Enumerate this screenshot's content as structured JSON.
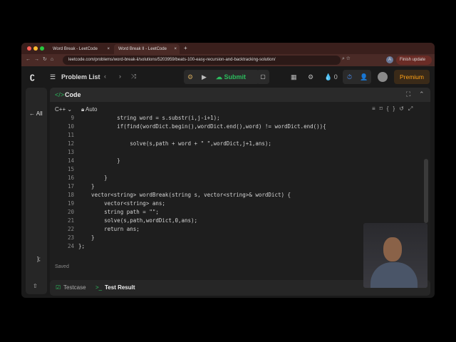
{
  "browser": {
    "tabs": [
      {
        "label": "Word Break - LeetCode"
      },
      {
        "label": "Word Break II - LeetCode"
      }
    ],
    "url": "leetcode.com/problems/word-break-ii/solutions/5203959/beats-100-easy-recursion-and-backtracking-solution/",
    "profile_initial": "A",
    "finish_update": "Finish update"
  },
  "header": {
    "problem_list": "Problem List",
    "submit": "Submit",
    "streak": "0",
    "premium": "Premium"
  },
  "left_panel": {
    "back": "All"
  },
  "editor": {
    "title": "Code",
    "language": "C++",
    "mode": "Auto",
    "status": "Saved",
    "lines": [
      {
        "n": "9",
        "code": "            string word = s.substr(i,j-i+1);"
      },
      {
        "n": "10",
        "code": "            if(find(wordDict.begin(),wordDict.end(),word) != wordDict.end()){"
      },
      {
        "n": "11",
        "code": ""
      },
      {
        "n": "12",
        "code": "                solve(s,path + word + \" \",wordDict,j+1,ans);"
      },
      {
        "n": "13",
        "code": ""
      },
      {
        "n": "14",
        "code": "            }"
      },
      {
        "n": "15",
        "code": ""
      },
      {
        "n": "16",
        "code": "        }"
      },
      {
        "n": "17",
        "code": "    }"
      },
      {
        "n": "18",
        "code": "    vector<string> wordBreak(string s, vector<string>& wordDict) {"
      },
      {
        "n": "19",
        "code": "        vector<string> ans;"
      },
      {
        "n": "20",
        "code": "        string path = \"\";"
      },
      {
        "n": "21",
        "code": "        solve(s,path,wordDict,0,ans);"
      },
      {
        "n": "22",
        "code": "        return ans;"
      },
      {
        "n": "23",
        "code": "    }"
      },
      {
        "n": "24",
        "code": "};"
      }
    ]
  },
  "bottom": {
    "testcase": "Testcase",
    "test_result": "Test Result"
  },
  "colors": {
    "submit": "#2cbb5d",
    "premium": "#ffa116",
    "accent_green": "#2cbb5d"
  }
}
